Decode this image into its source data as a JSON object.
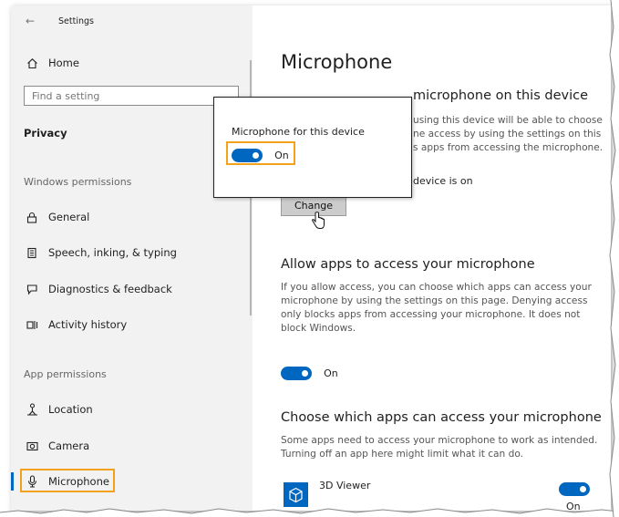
{
  "titlebar": {
    "back_icon": "back-arrow-icon",
    "title": "Settings"
  },
  "sidebar": {
    "home_label": "Home",
    "search_placeholder": "Find a setting",
    "category": "Privacy",
    "windows_permissions_header": "Windows permissions",
    "windows_items": [
      {
        "label": "General",
        "icon": "lock-icon"
      },
      {
        "label": "Speech, inking, & typing",
        "icon": "speech-icon"
      },
      {
        "label": "Diagnostics & feedback",
        "icon": "feedback-icon"
      },
      {
        "label": "Activity history",
        "icon": "timeline-icon"
      }
    ],
    "app_permissions_header": "App permissions",
    "app_items": [
      {
        "label": "Location",
        "icon": "location-icon"
      },
      {
        "label": "Camera",
        "icon": "camera-icon"
      },
      {
        "label": "Microphone",
        "icon": "microphone-icon",
        "selected": true
      }
    ]
  },
  "main": {
    "title": "Microphone",
    "section1_heading_partial": "microphone on this device",
    "section1_desc_lines": [
      "using this device will be able to choose",
      "ne access by using the settings on this",
      "s apps from accessing the microphone."
    ],
    "device_status_partial": "device is on",
    "change_button": "Change",
    "section2_heading": "Allow apps to access your microphone",
    "section2_desc": "If you allow access, you can choose which apps can access your microphone by using the settings on this page. Denying access only blocks apps from accessing your microphone. It does not block Windows.",
    "apps_toggle_label": "On",
    "section3_heading": "Choose which apps can access your microphone",
    "section3_desc": "Some apps need to access your microphone to work as intended. Turning off an app here might limit what it can do.",
    "apps": [
      {
        "name": "3D Viewer",
        "toggle_label": "On"
      }
    ]
  },
  "popup": {
    "title": "Microphone for this device",
    "toggle_label": "On"
  },
  "colors": {
    "accent": "#0067c0",
    "highlight": "#f2a31b",
    "sidebar_bg": "#f2f2f2"
  }
}
